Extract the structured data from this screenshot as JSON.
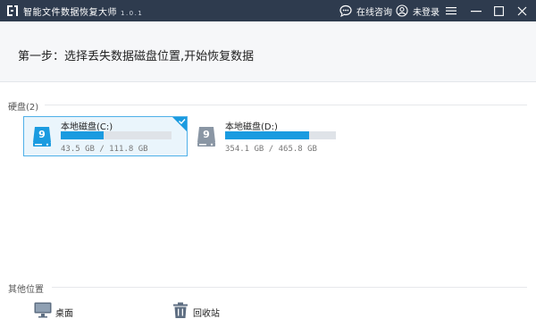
{
  "window": {
    "title": "智能文件数据恢复大师",
    "version": "1.0.1",
    "consult_label": "在线咨询",
    "login_label": "未登录",
    "bg_color": "#2e3b4e"
  },
  "step": {
    "title": "第一步：选择丢失数据磁盘位置,开始恢复数据"
  },
  "disks": {
    "section_label": "硬盘(2)",
    "items": [
      {
        "name": "本地磁盘(C:)",
        "size_text": "43.5 GB / 111.8 GB",
        "used_fraction": 0.389,
        "selected": true,
        "icon": "hard-drive-icon"
      },
      {
        "name": "本地磁盘(D:)",
        "size_text": "354.1 GB / 465.8 GB",
        "used_fraction": 0.76,
        "selected": false,
        "icon": "hard-drive-icon"
      }
    ]
  },
  "other": {
    "section_label": "其他位置",
    "items": [
      {
        "label": "桌面",
        "icon": "monitor-icon"
      },
      {
        "label": "回收站",
        "icon": "trash-icon"
      }
    ]
  },
  "colors": {
    "accent": "#1a9be0",
    "selected_bg": "#eaf5fc",
    "selected_border": "#4fb0e8"
  }
}
